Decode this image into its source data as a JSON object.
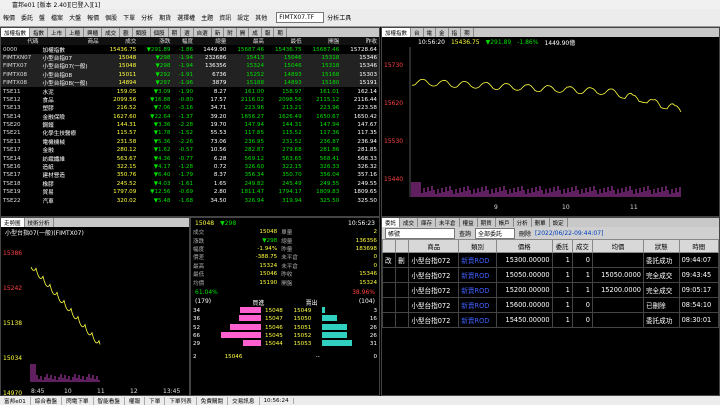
{
  "title": "富邦e01 [版本 2.40][已登入][1]",
  "menu": [
    "檔",
    "報價",
    "委託",
    "盤",
    "檔案",
    "大盤",
    "報價",
    "個股",
    "下單",
    "分析",
    "期貨",
    "選擇權",
    "主題",
    "資訊",
    "設定",
    "其他"
  ],
  "symbol_input": "FIMTX07.TF",
  "menu_right": "分析工具",
  "quote_tabs": [
    "加權指數",
    "指數",
    "上市",
    "上櫃",
    "興櫃",
    "成交",
    "觀",
    "類股",
    "個股",
    "期",
    "選",
    "自選",
    "新",
    "附",
    "開",
    "成",
    "報",
    "期"
  ],
  "quote_columns": [
    "代碼",
    "商品",
    "成交",
    "漲跌",
    "幅度",
    "總量",
    "最高",
    "最低",
    "開盤",
    "昨收"
  ],
  "quote_rows": [
    {
      "code": "0000",
      "name": "加權指數",
      "price": "15436.75",
      "chg": "▼291.89",
      "pct": "-1.86",
      "vol": "1449.90",
      "high": "15687.46",
      "low": "15436.75",
      "open": "15687.46",
      "prev": "15728.64",
      "c": "g"
    },
    {
      "code": "FIMTXN07",
      "name": "小型台指07",
      "price": "15048",
      "chg": "▼298",
      "pct": "-1.94",
      "vol": "232686",
      "high": "15413",
      "low": "15046",
      "open": "15318",
      "prev": "15346",
      "c": "g"
    },
    {
      "code": "FIMTX07",
      "name": "小型台指07(一般)",
      "price": "15048",
      "chg": "▼298",
      "pct": "-1.94",
      "vol": "136356",
      "high": "15324",
      "low": "15046",
      "open": "15318",
      "prev": "15346",
      "c": "g"
    },
    {
      "code": "FIMTX08",
      "name": "小型台指08",
      "price": "15011",
      "chg": "▼292",
      "pct": "-1.91",
      "vol": "6736",
      "high": "15252",
      "low": "14893",
      "open": "15168",
      "prev": "15303",
      "c": "g"
    },
    {
      "code": "FIMTX08",
      "name": "小型台指08(一般)",
      "price": "14894",
      "chg": "▼297",
      "pct": "-1.96",
      "vol": "3879",
      "high": "15188",
      "low": "14893",
      "open": "15180",
      "prev": "15191",
      "c": "g"
    },
    {
      "code": "TSE11",
      "name": "水泥",
      "price": "159.05",
      "chg": "▼3.09",
      "pct": "-1.90",
      "vol": "8.27",
      "high": "161.00",
      "low": "158.97",
      "open": "161.01",
      "prev": "162.14",
      "c": "g"
    },
    {
      "code": "TSE12",
      "name": "食品",
      "price": "2099.56",
      "chg": "▼16.88",
      "pct": "-0.80",
      "vol": "17.57",
      "high": "2116.02",
      "low": "2098.56",
      "open": "2115.12",
      "prev": "2116.44",
      "c": "g"
    },
    {
      "code": "TSE13",
      "name": "塑膠",
      "price": "216.52",
      "chg": "▼7.06",
      "pct": "-3.16",
      "vol": "34.71",
      "high": "223.96",
      "low": "213.21",
      "open": "223.96",
      "prev": "223.58",
      "c": "g"
    },
    {
      "code": "TSE14",
      "name": "金融保險",
      "price": "1627.60",
      "chg": "▼22.64",
      "pct": "-1.37",
      "vol": "39.20",
      "high": "1656.27",
      "low": "1626.49",
      "open": "1650.67",
      "prev": "1650.42",
      "c": "g"
    },
    {
      "code": "TSE20",
      "name": "鋼鐵",
      "price": "144.31",
      "chg": "▼3.36",
      "pct": "-2.28",
      "vol": "19.70",
      "high": "147.94",
      "low": "144.31",
      "open": "147.94",
      "prev": "147.67",
      "c": "g"
    },
    {
      "code": "TSE21",
      "name": "化學生技醫療",
      "price": "115.57",
      "chg": "▼1.78",
      "pct": "-1.52",
      "vol": "55.53",
      "high": "117.85",
      "low": "115.52",
      "open": "117.36",
      "prev": "117.35",
      "c": "g"
    },
    {
      "code": "TSE13",
      "name": "電機機械",
      "price": "231.58",
      "chg": "▼5.36",
      "pct": "-2.26",
      "vol": "73.06",
      "high": "236.95",
      "low": "231.52",
      "open": "236.87",
      "prev": "236.94",
      "c": "g"
    },
    {
      "code": "TSE17",
      "name": "金融",
      "price": "280.12",
      "chg": "▼1.62",
      "pct": "-0.57",
      "vol": "10.56",
      "high": "282.87",
      "low": "279.68",
      "open": "281.86",
      "prev": "281.85",
      "c": "g"
    },
    {
      "code": "TSE14",
      "name": "紡織纖維",
      "price": "563.67",
      "chg": "▼4.36",
      "pct": "-0.77",
      "vol": "6.28",
      "high": "569.12",
      "low": "563.65",
      "open": "568.41",
      "prev": "568.33",
      "c": "g"
    },
    {
      "code": "TSE16",
      "name": "造紙",
      "price": "322.15",
      "chg": "▼4.17",
      "pct": "-1.28",
      "vol": "0.72",
      "high": "326.60",
      "low": "322.15",
      "open": "326.33",
      "prev": "326.32",
      "c": "g"
    },
    {
      "code": "TSE17",
      "name": "建材營造",
      "price": "350.76",
      "chg": "▼6.40",
      "pct": "-1.79",
      "vol": "8.37",
      "high": "356.34",
      "low": "350.70",
      "open": "356.04",
      "prev": "357.16",
      "c": "g"
    },
    {
      "code": "TSE18",
      "name": "橡膠",
      "price": "245.52",
      "chg": "▼4.03",
      "pct": "-1.61",
      "vol": "1.65",
      "high": "249.82",
      "low": "245.49",
      "open": "249.55",
      "prev": "249.55",
      "c": "g"
    },
    {
      "code": "TSE19",
      "name": "貿易",
      "price": "1797.09",
      "chg": "▼12.56",
      "pct": "-0.69",
      "vol": "2.80",
      "high": "1811.47",
      "low": "1794.17",
      "open": "1809.83",
      "prev": "1809.65",
      "c": "g"
    },
    {
      "code": "TSE22",
      "name": "汽車",
      "price": "320.02",
      "chg": "▼5.48",
      "pct": "-1.68",
      "vol": "34.50",
      "high": "326.94",
      "low": "319.94",
      "open": "325.50",
      "prev": "325.50",
      "c": "g"
    }
  ],
  "index_chart": {
    "tabs": [
      "加權指數",
      "台",
      "電",
      "金",
      "指",
      "期"
    ],
    "time": "10:56:20",
    "price": "15436.75",
    "chg": "▼291.89",
    "pct": "-1.86%",
    "vol": "1449.90億",
    "ticks": [
      "15730",
      "15620",
      "15530",
      "15440"
    ],
    "xticks": [
      "9",
      "10",
      "11"
    ]
  },
  "fut_chart": {
    "tabs": [
      "走勢圖",
      "技術分析"
    ],
    "symbol": "小型台指07(一般)(FIMTX07)",
    "price": "15048",
    "chg": "▼298",
    "time": "10:56:23",
    "ylabels": [
      "15386",
      "15242",
      "15138",
      "15034",
      "14970"
    ],
    "xlabels": [
      "8:45",
      "10",
      "11",
      "12",
      "13:45"
    ],
    "bottom_tabs": [
      "報價",
      "價量表",
      "分價表",
      "分量表",
      "支撐壓力"
    ]
  },
  "detail": {
    "rows": [
      [
        "成交",
        "15048",
        "單量",
        "2"
      ],
      [
        "漲跌",
        "▼298",
        "總量",
        "136356"
      ],
      [
        "幅度",
        "-1.94%",
        "昨量",
        "183698"
      ],
      [
        "價差",
        "-388.75",
        "未平倉",
        "0"
      ],
      [
        "最高",
        "15324",
        "未平倉",
        "0"
      ],
      [
        "最低",
        "15046",
        "昨收",
        "15346"
      ],
      [
        "均價",
        "15190",
        "開盤",
        "15324"
      ]
    ],
    "bid_pct": "61.04%",
    "ask_pct": "38.96%",
    "bid_total": "(179)",
    "ask_total": "(104)",
    "bid_label": "買進",
    "ask_label": "賣出",
    "book": [
      [
        "34",
        "15048",
        "15049",
        "3"
      ],
      [
        "36",
        "15047",
        "15050",
        "16"
      ],
      [
        "52",
        "15046",
        "15051",
        "26"
      ],
      [
        "66",
        "15045",
        "15052",
        "26"
      ],
      [
        "29",
        "15044",
        "15053",
        "31"
      ]
    ],
    "book_bid": [
      34,
      36,
      52,
      66,
      29
    ],
    "book_ask": [
      3,
      16,
      26,
      26,
      31
    ],
    "footer": [
      "2",
      "15046",
      "--",
      "0"
    ]
  },
  "orders": {
    "tabs": [
      "委託",
      "成交",
      "庫存",
      "未平倉",
      "權益",
      "期貨",
      "帳戶",
      "分析",
      "刪單",
      "設定"
    ],
    "filter_acct": "帳號",
    "filter_type": "全部委託",
    "filter_btn": "查詢",
    "delete_btn": "刪除",
    "timestamp": "[2022/06/22-09:44:07]",
    "columns": [
      "",
      "",
      "商品",
      "類別",
      "價格",
      "委託",
      "成交",
      "均價",
      "狀態",
      "時間"
    ],
    "rows": [
      [
        "改",
        "刪",
        "小型台指072",
        "新賣ROD",
        "15300.00000",
        "1",
        "0",
        "",
        "委託成功",
        "09:44:07"
      ],
      [
        "",
        "",
        "小型台指072",
        "新賣ROD",
        "15050.00000",
        "1",
        "1",
        "15050.0000",
        "完全成交",
        "09:43:45"
      ],
      [
        "",
        "",
        "小型台指072",
        "新賣ROD",
        "15200.00000",
        "1",
        "1",
        "15200.0000",
        "完全成交",
        "09:05:17"
      ],
      [
        "",
        "",
        "小型台指072",
        "新賣ROD",
        "15600.00000",
        "1",
        "0",
        "",
        "已刪除",
        "08:54:10"
      ],
      [
        "",
        "",
        "小型台指072",
        "新賣ROD",
        "15450.00000",
        "1",
        "0",
        "",
        "委託成功",
        "08:30:01"
      ]
    ]
  },
  "statusbar": [
    "富邦e01",
    "綜合看盤",
    "閃電下單",
    "智能看盤",
    "權報",
    "下單",
    "下單列表",
    "免費購閱",
    "交易訊息",
    "10:56:24"
  ],
  "colors": {
    "up": "#ff4040",
    "down": "#00e000",
    "price": "#ffff40",
    "bg": "#000000"
  }
}
